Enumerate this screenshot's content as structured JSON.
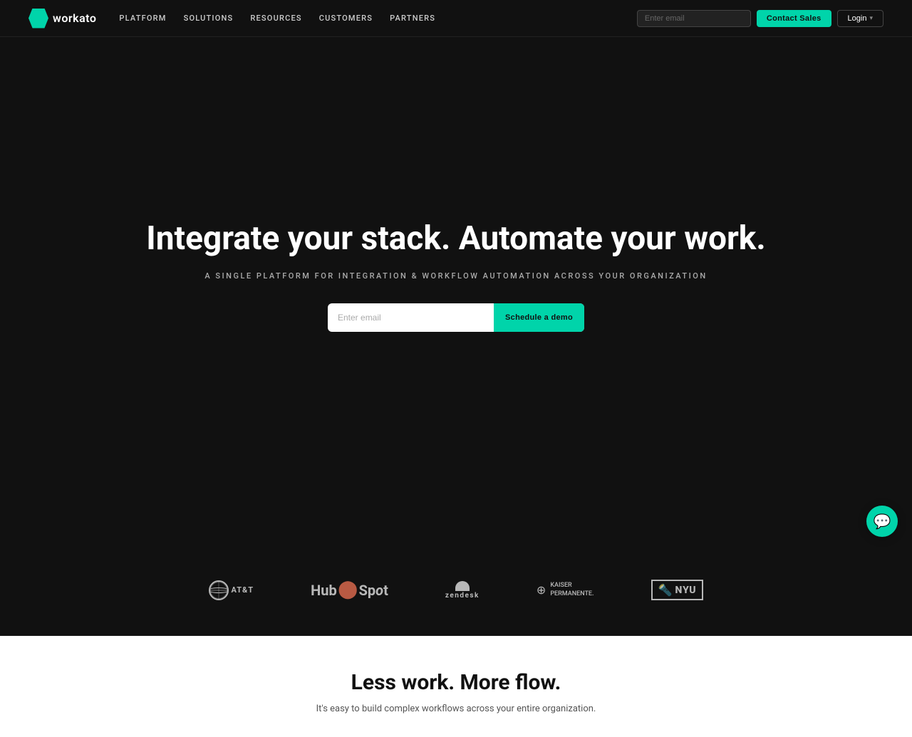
{
  "nav": {
    "logo_text": "workato",
    "links": [
      {
        "id": "platform",
        "label": "PLATFORM"
      },
      {
        "id": "solutions",
        "label": "SOLUTIONS"
      },
      {
        "id": "resources",
        "label": "RESOURCES"
      },
      {
        "id": "customers",
        "label": "CUSTOMERS"
      },
      {
        "id": "partners",
        "label": "PARTNERS"
      }
    ],
    "email_placeholder": "Enter email",
    "contact_sales_label": "Contact Sales",
    "login_label": "Login"
  },
  "hero": {
    "title": "Integrate your stack. Automate your work.",
    "subtitle": "A SINGLE PLATFORM FOR INTEGRATION & WORKFLOW AUTOMATION ACROSS YOUR ORGANIZATION",
    "email_placeholder": "Enter email",
    "demo_button_label": "Schedule a demo"
  },
  "logos": [
    {
      "id": "att",
      "alt": "AT&T"
    },
    {
      "id": "hubspot",
      "alt": "HubSpot"
    },
    {
      "id": "zendesk",
      "alt": "Zendesk"
    },
    {
      "id": "kaiser",
      "alt": "Kaiser Permanente"
    },
    {
      "id": "nyu",
      "alt": "NYU"
    }
  ],
  "bottom": {
    "title": "Less work. More flow.",
    "subtitle": "It's easy to build complex workflows across your entire organization."
  },
  "chat": {
    "icon": "💬"
  }
}
